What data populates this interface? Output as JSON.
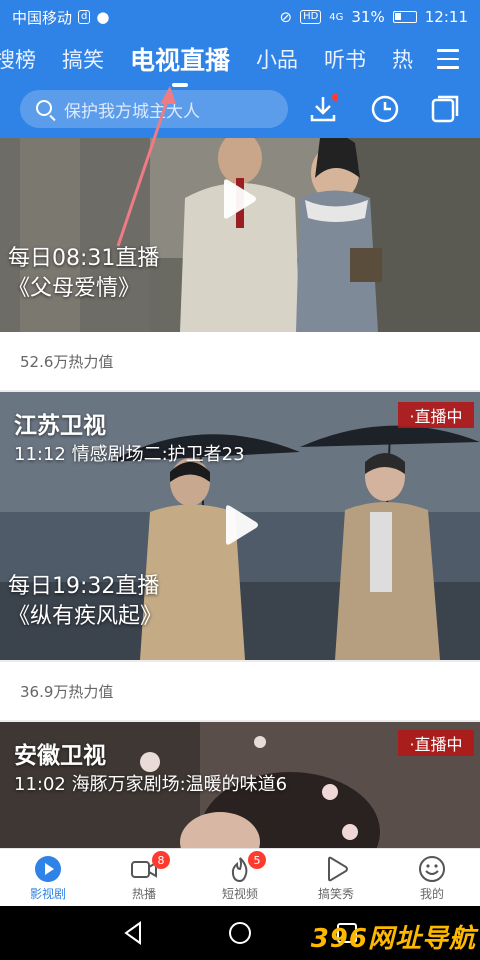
{
  "status_bar": {
    "carrier": "中国移动",
    "network_badge": "HD",
    "signal": "4G",
    "battery": "31%",
    "time": "12:11"
  },
  "tabs": [
    "搜榜",
    "搞笑",
    "电视直播",
    "小品",
    "听书",
    "热"
  ],
  "active_tab": "电视直播",
  "search": {
    "placeholder": "保护我方城主大人"
  },
  "cards": [
    {
      "schedule": "每日08:31直播",
      "show": "《父母爱情》",
      "heat": "52.6万热力值"
    },
    {
      "channel": "江苏卫视",
      "program": "11:12 情感剧场二:护卫者23",
      "live": "·直播中",
      "schedule": "每日19:32直播",
      "show": "《纵有疾风起》",
      "heat": "36.9万热力值"
    },
    {
      "channel": "安徽卫视",
      "program": "11:02 海豚万家剧场:温暖的味道6",
      "live": "·直播中"
    }
  ],
  "bottom_nav": [
    {
      "label": "影视剧",
      "icon": "play-circle-icon",
      "active": true
    },
    {
      "label": "热播",
      "icon": "video-camera-icon",
      "badge": "8"
    },
    {
      "label": "短视频",
      "icon": "flame-icon",
      "badge": "5"
    },
    {
      "label": "搞笑秀",
      "icon": "play-outline-icon"
    },
    {
      "label": "我的",
      "icon": "smiley-icon"
    }
  ],
  "watermark": "396网址导航",
  "colors": {
    "brand": "#2f82e6",
    "live": "#b21818",
    "badge": "#ff3b30"
  }
}
